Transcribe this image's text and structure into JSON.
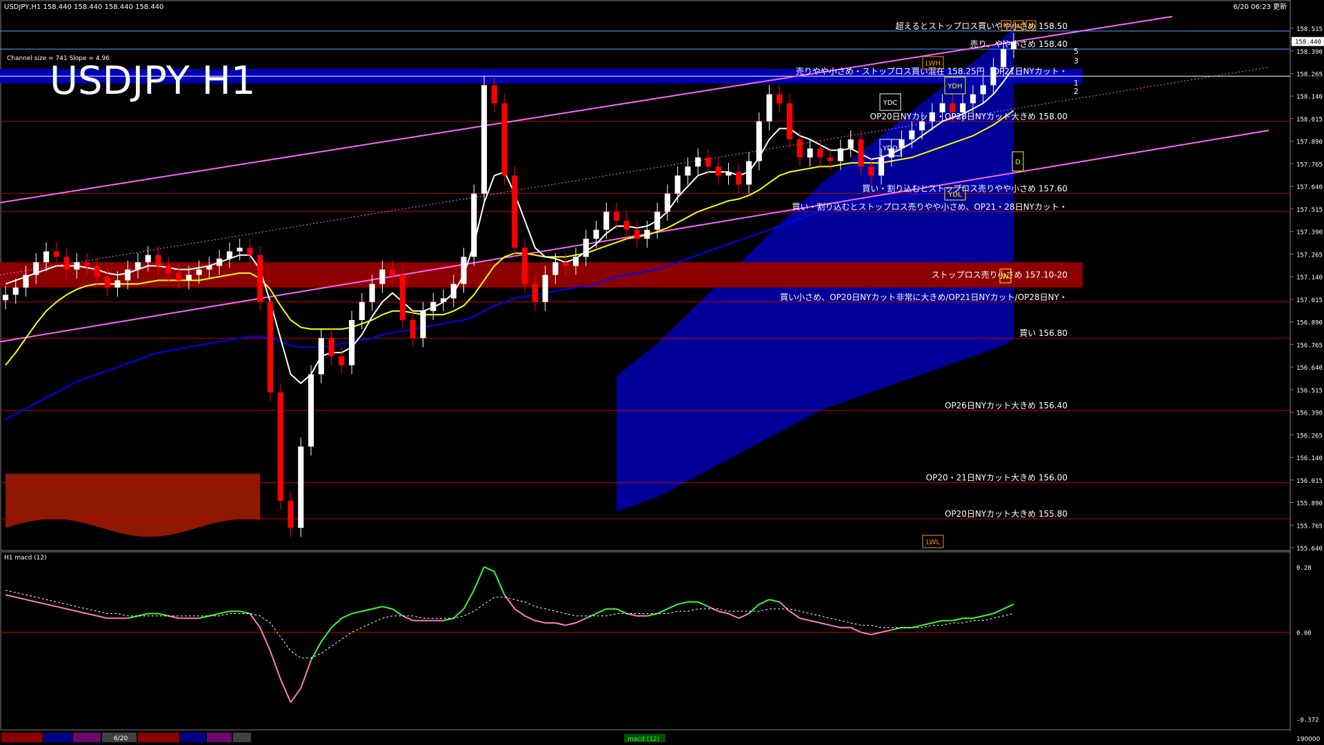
{
  "header": {
    "symbol_info": "USDJPY,H1  158.440 158.440 158.440 158.440",
    "datetime": "6/20 06:23 更新",
    "channel_info": "Channel size = 741 Slope = 4.96",
    "big_title": "USDJPY H1"
  },
  "colors": {
    "background": "#000000",
    "bull_candle": "#ffffff",
    "bear_candle": "#ff0000",
    "level_line": "#c80000",
    "channel": "#ff66ff",
    "ma_fast": "#ffffff",
    "ma_mid": "#ffff00",
    "ma_slow": "#0000ff",
    "cloud_blue": "#0000cc",
    "cloud_red": "#cc2200",
    "macd_up": "#33ff33",
    "macd_down": "#ff7fbf",
    "blue_band": "#0000b4",
    "red_band": "#8c0000"
  },
  "chart_data": {
    "type": "line",
    "title": "USDJPY H1",
    "y_ticks": [
      "158.515",
      "158.440",
      "158.390",
      "158.265",
      "158.140",
      "158.015",
      "157.890",
      "157.765",
      "157.640",
      "157.515",
      "157.390",
      "157.265",
      "157.140",
      "157.015",
      "156.890",
      "156.765",
      "156.640",
      "156.515",
      "156.390",
      "156.265",
      "156.140",
      "156.015",
      "155.890",
      "155.765",
      "155.640"
    ],
    "current_price": "158.440",
    "ylim": [
      155.64,
      158.58
    ],
    "x_count": 100,
    "close": [
      157.04,
      157.08,
      157.15,
      157.22,
      157.28,
      157.25,
      157.18,
      157.22,
      157.2,
      157.14,
      157.08,
      157.12,
      157.18,
      157.22,
      157.26,
      157.2,
      157.16,
      157.12,
      157.15,
      157.18,
      157.2,
      157.24,
      157.28,
      157.3,
      157.26,
      157.0,
      156.5,
      155.9,
      155.75,
      156.2,
      156.6,
      156.8,
      156.7,
      156.65,
      156.9,
      157.0,
      157.1,
      157.18,
      157.15,
      156.9,
      156.8,
      156.95,
      157.0,
      157.02,
      157.1,
      157.25,
      157.6,
      158.2,
      158.1,
      157.7,
      157.3,
      157.1,
      157.0,
      157.15,
      157.22,
      157.2,
      157.25,
      157.35,
      157.4,
      157.5,
      157.45,
      157.4,
      157.35,
      157.4,
      157.5,
      157.6,
      157.7,
      157.75,
      157.8,
      157.75,
      157.7,
      157.72,
      157.65,
      157.78,
      158.0,
      158.15,
      158.1,
      157.9,
      157.8,
      157.85,
      157.8,
      157.78,
      157.85,
      157.9,
      157.75,
      157.7,
      157.8,
      157.85,
      157.9,
      157.95,
      158.0,
      158.05,
      158.1,
      158.05,
      158.1,
      158.15,
      158.2,
      158.3,
      158.4,
      158.44
    ],
    "ma_fast": [
      157.1,
      157.12,
      157.14,
      157.16,
      157.18,
      157.2,
      157.2,
      157.2,
      157.19,
      157.18,
      157.16,
      157.15,
      157.16,
      157.18,
      157.2,
      157.2,
      157.19,
      157.18,
      157.18,
      157.19,
      157.2,
      157.22,
      157.24,
      157.26,
      157.26,
      157.18,
      157.0,
      156.8,
      156.6,
      156.55,
      156.6,
      156.7,
      156.72,
      156.72,
      156.75,
      156.82,
      156.92,
      157.0,
      157.05,
      157.0,
      156.95,
      156.95,
      156.97,
      157.0,
      157.05,
      157.15,
      157.32,
      157.55,
      157.7,
      157.72,
      157.6,
      157.45,
      157.3,
      157.25,
      157.24,
      157.22,
      157.24,
      157.28,
      157.32,
      157.38,
      157.42,
      157.42,
      157.41,
      157.42,
      157.45,
      157.5,
      157.58,
      157.64,
      157.7,
      157.72,
      157.72,
      157.72,
      157.7,
      157.72,
      157.8,
      157.9,
      157.96,
      157.96,
      157.92,
      157.9,
      157.87,
      157.84,
      157.84,
      157.85,
      157.82,
      157.79,
      157.8,
      157.82,
      157.85,
      157.88,
      157.92,
      157.96,
      158.0,
      158.02,
      158.04,
      158.07,
      158.1,
      158.15,
      158.22,
      158.3
    ],
    "ma_mid": [
      156.65,
      156.72,
      156.8,
      156.88,
      156.95,
      157.0,
      157.04,
      157.07,
      157.09,
      157.1,
      157.1,
      157.1,
      157.1,
      157.1,
      157.11,
      157.12,
      157.12,
      157.12,
      157.12,
      157.12,
      157.13,
      157.14,
      157.15,
      157.16,
      157.16,
      157.13,
      157.07,
      156.98,
      156.9,
      156.86,
      156.85,
      156.85,
      156.85,
      156.85,
      156.86,
      156.88,
      156.9,
      156.93,
      156.95,
      156.95,
      156.94,
      156.93,
      156.93,
      156.93,
      156.95,
      156.98,
      157.04,
      157.12,
      157.2,
      157.25,
      157.27,
      157.27,
      157.26,
      157.25,
      157.25,
      157.25,
      157.26,
      157.27,
      157.29,
      157.31,
      157.33,
      157.35,
      157.36,
      157.37,
      157.39,
      157.41,
      157.44,
      157.47,
      157.5,
      157.52,
      157.54,
      157.56,
      157.57,
      157.59,
      157.62,
      157.66,
      157.7,
      157.72,
      157.73,
      157.74,
      157.75,
      157.75,
      157.76,
      157.77,
      157.77,
      157.77,
      157.77,
      157.78,
      157.79,
      157.8,
      157.82,
      157.84,
      157.86,
      157.88,
      157.9,
      157.92,
      157.95,
      157.98,
      158.02,
      158.06
    ],
    "ma_slow": [
      156.35,
      156.38,
      156.41,
      156.44,
      156.47,
      156.5,
      156.53,
      156.56,
      156.58,
      156.6,
      156.62,
      156.64,
      156.66,
      156.68,
      156.7,
      156.72,
      156.73,
      156.74,
      156.75,
      156.76,
      156.77,
      156.78,
      156.79,
      156.8,
      156.81,
      156.81,
      156.8,
      156.78,
      156.76,
      156.75,
      156.75,
      156.75,
      156.76,
      156.77,
      156.78,
      156.79,
      156.8,
      156.82,
      156.83,
      156.84,
      156.85,
      156.86,
      156.87,
      156.88,
      156.89,
      156.9,
      156.92,
      156.95,
      156.98,
      157.0,
      157.02,
      157.03,
      157.04,
      157.05,
      157.06,
      157.07,
      157.08,
      157.09,
      157.1,
      157.12,
      157.14,
      157.15,
      157.16,
      157.17,
      157.18,
      157.2,
      157.22,
      157.24,
      157.26,
      157.28,
      157.3,
      157.32,
      157.34,
      157.36,
      157.38,
      157.4,
      157.42,
      157.44,
      157.46,
      157.48,
      157.5,
      157.51,
      157.52,
      157.53,
      157.54,
      157.55,
      157.56,
      157.57,
      157.58,
      157.59,
      157.6,
      157.61,
      157.62,
      157.63,
      157.64,
      157.65,
      157.66,
      157.67,
      157.68,
      157.7
    ],
    "macd": [
      0.16,
      0.15,
      0.14,
      0.13,
      0.12,
      0.11,
      0.1,
      0.09,
      0.08,
      0.07,
      0.06,
      0.06,
      0.06,
      0.07,
      0.08,
      0.08,
      0.07,
      0.06,
      0.06,
      0.06,
      0.07,
      0.08,
      0.09,
      0.09,
      0.08,
      0.02,
      -0.08,
      -0.2,
      -0.3,
      -0.24,
      -0.12,
      -0.04,
      0.02,
      0.06,
      0.08,
      0.09,
      0.1,
      0.11,
      0.1,
      0.07,
      0.05,
      0.05,
      0.05,
      0.05,
      0.06,
      0.1,
      0.18,
      0.28,
      0.26,
      0.16,
      0.1,
      0.07,
      0.05,
      0.04,
      0.04,
      0.03,
      0.04,
      0.06,
      0.08,
      0.1,
      0.1,
      0.08,
      0.07,
      0.07,
      0.08,
      0.1,
      0.12,
      0.13,
      0.13,
      0.11,
      0.09,
      0.08,
      0.06,
      0.08,
      0.12,
      0.14,
      0.13,
      0.09,
      0.06,
      0.05,
      0.04,
      0.03,
      0.02,
      0.02,
      0.0,
      -0.01,
      0.0,
      0.01,
      0.02,
      0.02,
      0.03,
      0.04,
      0.05,
      0.05,
      0.06,
      0.06,
      0.07,
      0.08,
      0.1,
      0.12
    ],
    "macd_signal": [
      0.18,
      0.17,
      0.16,
      0.15,
      0.14,
      0.13,
      0.12,
      0.11,
      0.1,
      0.09,
      0.08,
      0.08,
      0.07,
      0.07,
      0.07,
      0.07,
      0.07,
      0.07,
      0.07,
      0.07,
      0.07,
      0.07,
      0.08,
      0.08,
      0.08,
      0.07,
      0.04,
      -0.02,
      -0.08,
      -0.11,
      -0.11,
      -0.09,
      -0.06,
      -0.03,
      0.0,
      0.02,
      0.04,
      0.06,
      0.07,
      0.07,
      0.07,
      0.06,
      0.06,
      0.06,
      0.06,
      0.07,
      0.09,
      0.12,
      0.15,
      0.15,
      0.14,
      0.13,
      0.11,
      0.1,
      0.09,
      0.08,
      0.07,
      0.07,
      0.07,
      0.07,
      0.08,
      0.08,
      0.08,
      0.08,
      0.08,
      0.08,
      0.09,
      0.09,
      0.1,
      0.1,
      0.1,
      0.09,
      0.09,
      0.09,
      0.09,
      0.1,
      0.1,
      0.1,
      0.09,
      0.08,
      0.07,
      0.06,
      0.05,
      0.04,
      0.03,
      0.03,
      0.02,
      0.02,
      0.02,
      0.02,
      0.02,
      0.03,
      0.03,
      0.04,
      0.04,
      0.05,
      0.05,
      0.06,
      0.07,
      0.08
    ],
    "macd_label": "H1  macd (12)",
    "macd_ticks": [
      "0.28",
      "0.00",
      "-0.372"
    ],
    "macd_ylim": [
      -0.4,
      0.3
    ],
    "bottom_right": "190000",
    "bottom_tab": "6/20",
    "bottom_label": "macd (12)",
    "levels": [
      {
        "price": 158.5,
        "label": "超えるとストップロス買いやや小さめ 158.50",
        "color": "#5aa0ff"
      },
      {
        "price": 158.4,
        "label": "売り、やや小さめ 158.40",
        "color": "#5aa0ff"
      },
      {
        "price": 158.25,
        "label": "売りやや小さめ・ストップロス買い混在 158.25円　OP21日NYカット・",
        "color": "#ffffff"
      },
      {
        "price": 158.0,
        "label": "OP20日NYカット・OP28日NYカット大きめ 158.00",
        "color": "#c80000"
      },
      {
        "price": 157.6,
        "label": "買い・割り込むとストップロス売りやや小さめ 157.60",
        "color": "#c80000"
      },
      {
        "price": 157.5,
        "label": "買い・割り込むとストップロス売りやや小さめ、OP21・28日NYカット・",
        "color": "#c80000"
      },
      {
        "price": 157.0,
        "label": "買い小さめ、OP20日NYカット非常に大きめ/OP21日NYカット/OP28日NY・",
        "color": "#c80000"
      },
      {
        "price": 156.8,
        "label": "買い 156.80",
        "color": "#c80000"
      },
      {
        "price": 156.4,
        "label": "OP26日NYカット大きめ 156.40",
        "color": "#c80000"
      },
      {
        "price": 156.0,
        "label": "OP20・21日NYカット大きめ 156.00",
        "color": "#c80000"
      },
      {
        "price": 155.8,
        "label": "OP20日NYカット大きめ 155.80",
        "color": "#c80000"
      }
    ],
    "red_band_label": "ストップロス売り小さめ 157.10-20",
    "markers": {
      "ydc": "YDC",
      "ydo": "YDO",
      "ydh": "YDH",
      "ydl": "YDL",
      "lwh": "LWH",
      "lwl": "LWL",
      "w": "W",
      "d": "D",
      "m": "M"
    },
    "channel_numbers": [
      "5",
      "3",
      "1",
      "2"
    ]
  }
}
